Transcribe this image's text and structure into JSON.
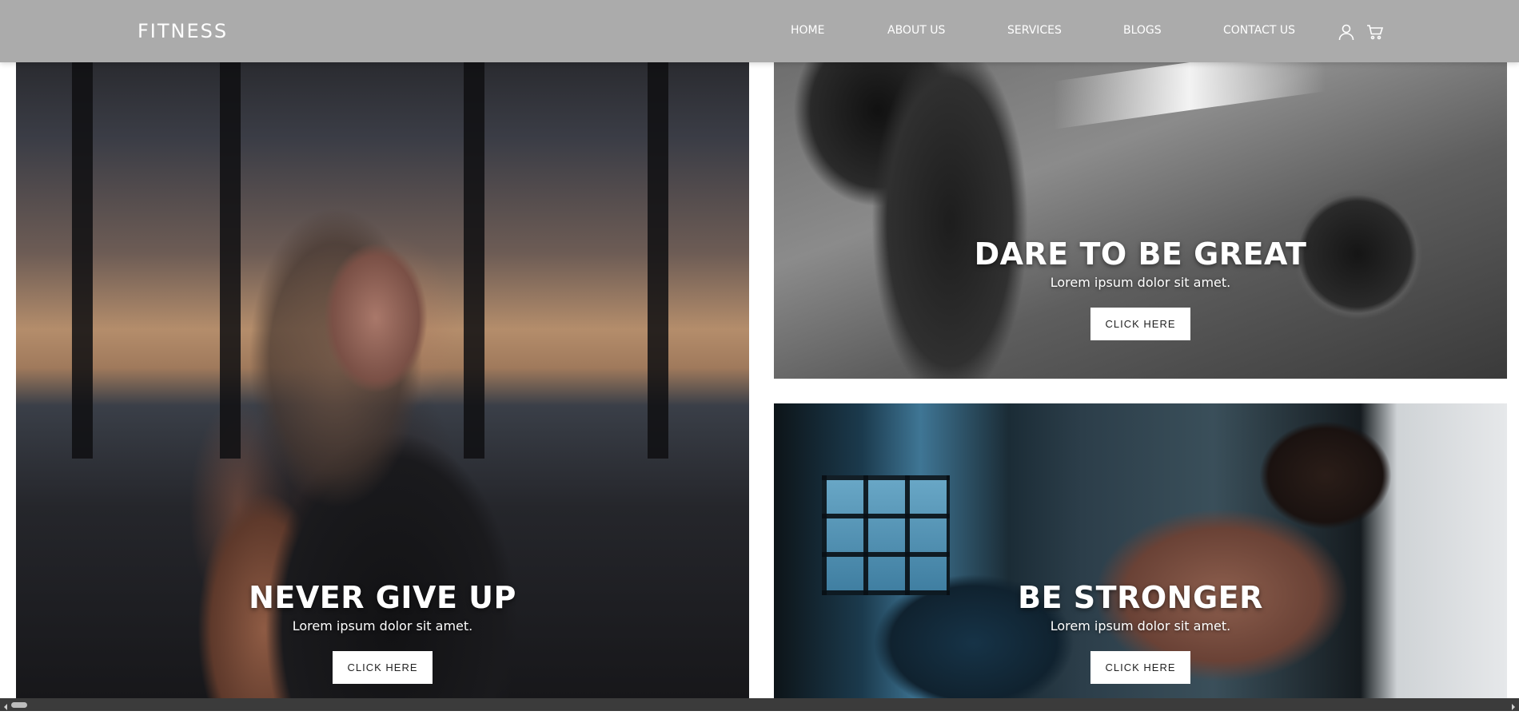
{
  "brand": "FITNESS",
  "nav": {
    "links": [
      {
        "label": "HOME",
        "name": "nav-link-home"
      },
      {
        "label": "ABOUT US",
        "name": "nav-link-about-us"
      },
      {
        "label": "SERVICES",
        "name": "nav-link-services"
      },
      {
        "label": "BLOGS",
        "name": "nav-link-blogs"
      },
      {
        "label": "CONTACT US",
        "name": "nav-link-contact-us"
      }
    ],
    "icons": [
      "user-icon",
      "cart-icon"
    ]
  },
  "cards": [
    {
      "title": "NEVER GIVE UP",
      "subtitle": "Lorem ipsum dolor sit amet.",
      "button": "CLICK HERE"
    },
    {
      "title": "DARE TO BE GREAT",
      "subtitle": "Lorem ipsum dolor sit amet.",
      "button": "CLICK HERE"
    },
    {
      "title": "BE STRONGER",
      "subtitle": "Lorem ipsum dolor sit amet.",
      "button": "CLICK HERE"
    }
  ],
  "colors": {
    "navbar_bg": "#ababab",
    "nav_text": "#ffffff",
    "button_bg": "#ffffff",
    "button_text": "#222222",
    "scrollbar_bg": "#3b3b3b"
  }
}
